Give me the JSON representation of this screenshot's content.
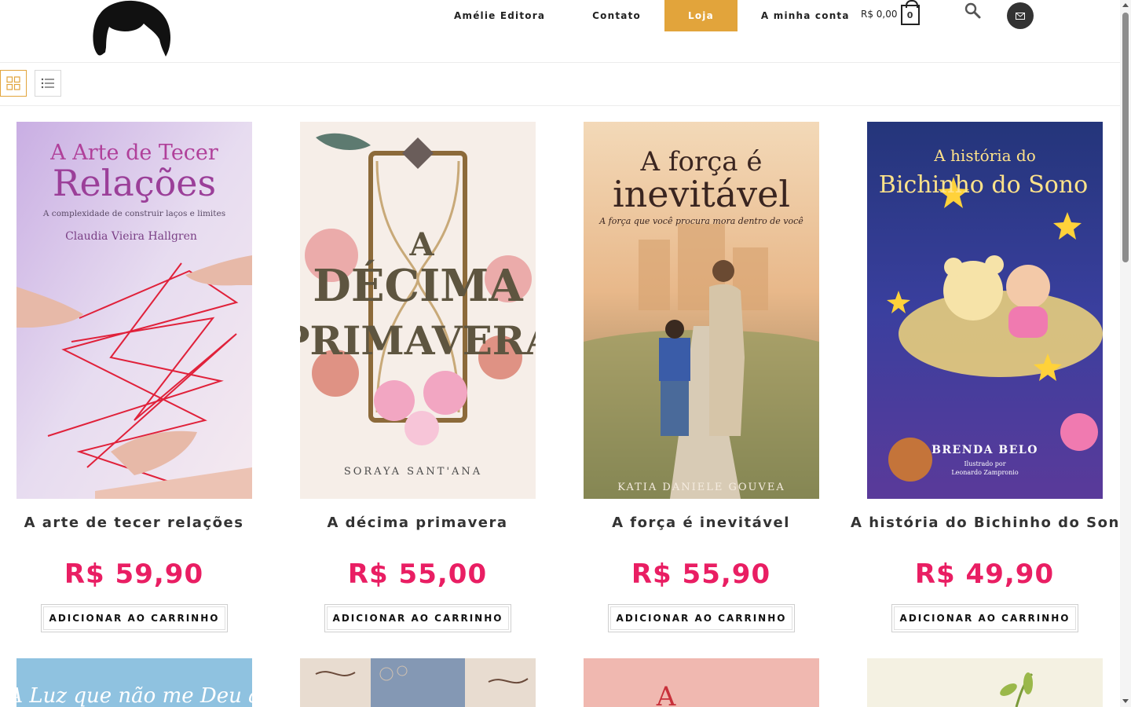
{
  "header": {
    "nav": [
      {
        "label": "Amélie Editora",
        "active": false
      },
      {
        "label": "Contato",
        "active": false
      },
      {
        "label": "Loja",
        "active": true
      },
      {
        "label": "A minha conta",
        "active": false
      }
    ],
    "cart_total": "R$ 0,00",
    "cart_count": "0",
    "accent_color": "#e2a43b"
  },
  "toolbar": {
    "views": [
      "grid-view",
      "list-view"
    ],
    "selected_view": "grid-view"
  },
  "products": [
    {
      "title": "A arte de tecer relações",
      "price": "R$ 59,90",
      "button": "ADICIONAR AO CARRINHO",
      "cover": {
        "title_line1": "A Arte de Tecer",
        "title_line2": "Relações",
        "subtitle": "A complexidade de construir laços e limites",
        "author": "Claudia Vieira Hallgren"
      }
    },
    {
      "title": "A décima primavera",
      "price": "R$ 55,00",
      "button": "ADICIONAR AO CARRINHO",
      "cover": {
        "title_line1": "A",
        "title_line2": "DÉCIMA",
        "title_line3": "PRIMAVERA",
        "author": "SORAYA SANT'ANA"
      }
    },
    {
      "title": "A força é inevitável",
      "price": "R$ 55,90",
      "button": "ADICIONAR AO CARRINHO",
      "cover": {
        "title_line1": "A força é",
        "title_line2": "inevitável",
        "subtitle": "A força que você procura mora dentro de você",
        "author": "KATIA DANIELE GOUVEA"
      }
    },
    {
      "title": "A história do Bichinho do Sono",
      "price": "R$ 49,90",
      "button": "ADICIONAR AO CARRINHO",
      "cover": {
        "title_line1": "A história do",
        "title_line2": "Bichinho do Sono",
        "author": "BRENDA BELO",
        "illustrator_line1": "Ilustrado por",
        "illustrator_line2": "Leonardo Zampronio"
      }
    }
  ],
  "row2": [
    {
      "cover_text": "A Luz que não me Deu à"
    },
    {
      "cover_text": ""
    },
    {
      "cover_text": "A"
    },
    {
      "cover_text": ""
    }
  ],
  "price_color": "#e91e63"
}
